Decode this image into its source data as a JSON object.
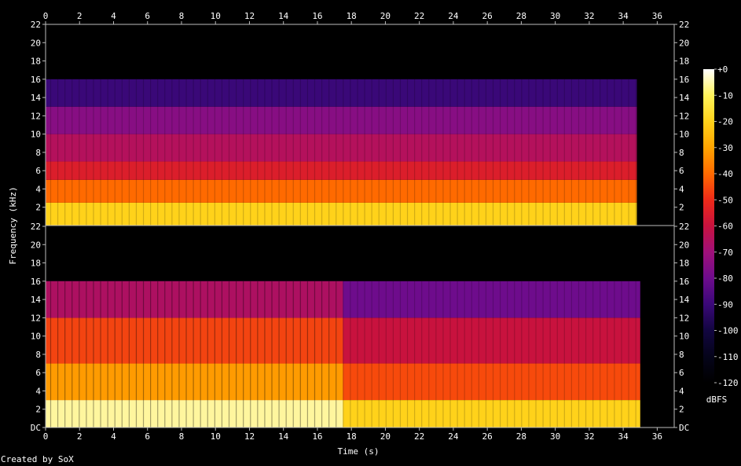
{
  "chart_data": {
    "type": "heatmap",
    "credit": "Created by SoX",
    "xlabel": "Time (s)",
    "ylabel": "Frequency (kHz)",
    "xlim": [
      0,
      37
    ],
    "ylim": [
      0,
      22
    ],
    "x_ticks": [
      "0",
      "2",
      "4",
      "6",
      "8",
      "10",
      "12",
      "14",
      "16",
      "18",
      "20",
      "22",
      "24",
      "26",
      "28",
      "30",
      "32",
      "34",
      "36"
    ],
    "y_ticks_top": [
      "2",
      "4",
      "6",
      "8",
      "10",
      "12",
      "14",
      "16",
      "18",
      "20",
      "22"
    ],
    "y_ticks_bottom": [
      "DC",
      "2",
      "4",
      "6",
      "8",
      "10",
      "12",
      "14",
      "16",
      "18",
      "20",
      "22"
    ],
    "colorbar": {
      "unit": "dBFS",
      "ticks": [
        "+0",
        "-10",
        "-20",
        "-30",
        "-40",
        "-50",
        "-60",
        "-70",
        "-80",
        "-90",
        "-100",
        "-110",
        "-120"
      ],
      "colors": [
        "#ffffff",
        "#fff35a",
        "#ffd21a",
        "#ffa400",
        "#ff6a00",
        "#ee2a18",
        "#c8123e",
        "#a0107a",
        "#6e0c8c",
        "#3a0878",
        "#120640",
        "#05041a",
        "#000000"
      ]
    },
    "channels": [
      {
        "audio_end_s": 34.8,
        "bands_khz": [
          {
            "top": 2.5,
            "level_db": -20
          },
          {
            "top": 5.0,
            "level_db": -40
          },
          {
            "top": 7.0,
            "level_db": -55
          },
          {
            "top": 10.0,
            "level_db": -65
          },
          {
            "top": 13.0,
            "level_db": -75
          },
          {
            "top": 16.0,
            "level_db": -90
          }
        ]
      },
      {
        "audio_end_s": 35.0,
        "loud_until_s": 17.5,
        "bands_khz": [
          {
            "top": 3.0,
            "level_db": -20
          },
          {
            "top": 7.0,
            "level_db": -45
          },
          {
            "top": 12.0,
            "level_db": -60
          },
          {
            "top": 16.0,
            "level_db": -80
          }
        ]
      }
    ]
  }
}
